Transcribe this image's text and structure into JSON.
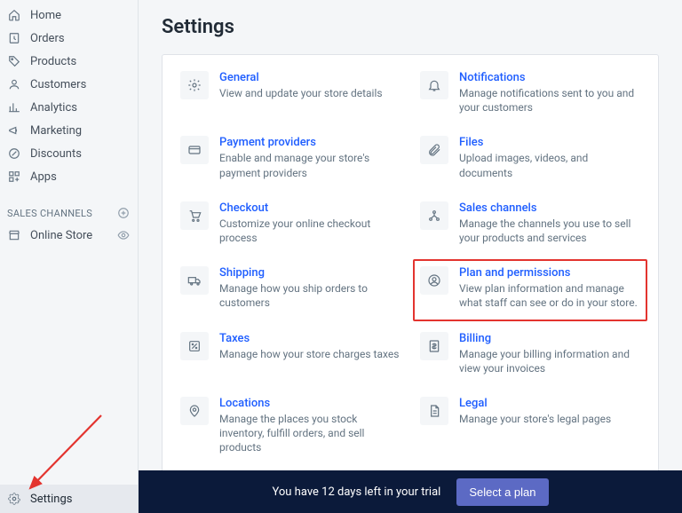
{
  "sidebar": {
    "nav": [
      {
        "label": "Home"
      },
      {
        "label": "Orders"
      },
      {
        "label": "Products"
      },
      {
        "label": "Customers"
      },
      {
        "label": "Analytics"
      },
      {
        "label": "Marketing"
      },
      {
        "label": "Discounts"
      },
      {
        "label": "Apps"
      }
    ],
    "sales_channels_header": "SALES CHANNELS",
    "channels": [
      {
        "label": "Online Store"
      }
    ],
    "settings_label": "Settings"
  },
  "page": {
    "title": "Settings"
  },
  "tiles": {
    "general": {
      "title": "General",
      "desc": "View and update your store details"
    },
    "notifications": {
      "title": "Notifications",
      "desc": "Manage notifications sent to you and your customers"
    },
    "payment": {
      "title": "Payment providers",
      "desc": "Enable and manage your store's payment providers"
    },
    "files": {
      "title": "Files",
      "desc": "Upload images, videos, and documents"
    },
    "checkout": {
      "title": "Checkout",
      "desc": "Customize your online checkout process"
    },
    "sales_channels": {
      "title": "Sales channels",
      "desc": "Manage the channels you use to sell your products and services"
    },
    "shipping": {
      "title": "Shipping",
      "desc": "Manage how you ship orders to customers"
    },
    "plan": {
      "title": "Plan and permissions",
      "desc": "View plan information and manage what staff can see or do in your store."
    },
    "taxes": {
      "title": "Taxes",
      "desc": "Manage how your store charges taxes"
    },
    "billing": {
      "title": "Billing",
      "desc": "Manage your billing information and view your invoices"
    },
    "locations": {
      "title": "Locations",
      "desc": "Manage the places you stock inventory, fulfill orders, and sell products"
    },
    "legal": {
      "title": "Legal",
      "desc": "Manage your store's legal pages"
    }
  },
  "trial": {
    "message": "You have 12 days left in your trial",
    "cta": "Select a plan"
  }
}
